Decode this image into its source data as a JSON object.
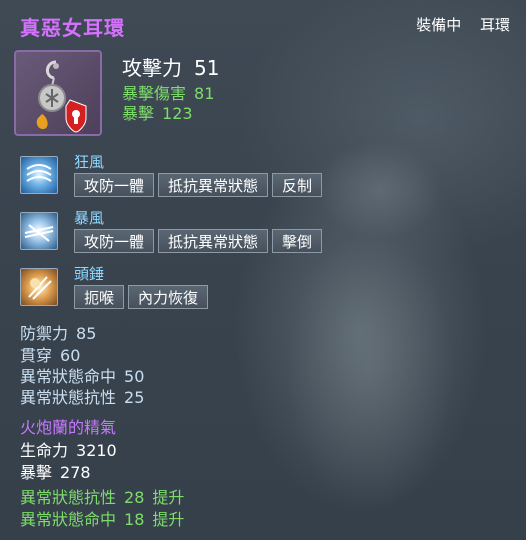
{
  "item": {
    "name": "真惡女耳環",
    "status": "裝備中",
    "slot": "耳環",
    "icon": "earring-icon"
  },
  "main_stats": {
    "attack_label": "攻擊力",
    "attack_value": "51",
    "crit_damage_label": "暴擊傷害",
    "crit_damage_value": "81",
    "crit_label": "暴擊",
    "crit_value": "123"
  },
  "skills": [
    {
      "name": "狂風",
      "icon": "whirlwind-skill-icon",
      "tags": [
        "攻防一體",
        "抵抗異常狀態",
        "反制"
      ]
    },
    {
      "name": "暴風",
      "icon": "storm-skill-icon",
      "tags": [
        "攻防一體",
        "抵抗異常狀態",
        "擊倒"
      ]
    },
    {
      "name": "頭錘",
      "icon": "headbutt-skill-icon",
      "tags": [
        "扼喉",
        "內力恢復"
      ]
    }
  ],
  "sub_stats": [
    {
      "label": "防禦力",
      "value": "85"
    },
    {
      "label": "貫穿",
      "value": "60"
    },
    {
      "label": "異常狀態命中",
      "value": "50"
    },
    {
      "label": "異常狀態抗性",
      "value": "25"
    }
  ],
  "set_bonus": {
    "name": "火炮蘭的精氣",
    "stats": [
      {
        "label": "生命力",
        "value": "3210"
      },
      {
        "label": "暴擊",
        "value": "278"
      }
    ],
    "upgrades": [
      {
        "label": "異常狀態抗性",
        "value": "28",
        "suffix": "提升"
      },
      {
        "label": "異常狀態命中",
        "value": "18",
        "suffix": "提升"
      }
    ]
  },
  "colors": {
    "title": "#d670ff",
    "green": "#7edc6a",
    "skill": "#8fd8ff",
    "set_name": "#c678ff"
  }
}
